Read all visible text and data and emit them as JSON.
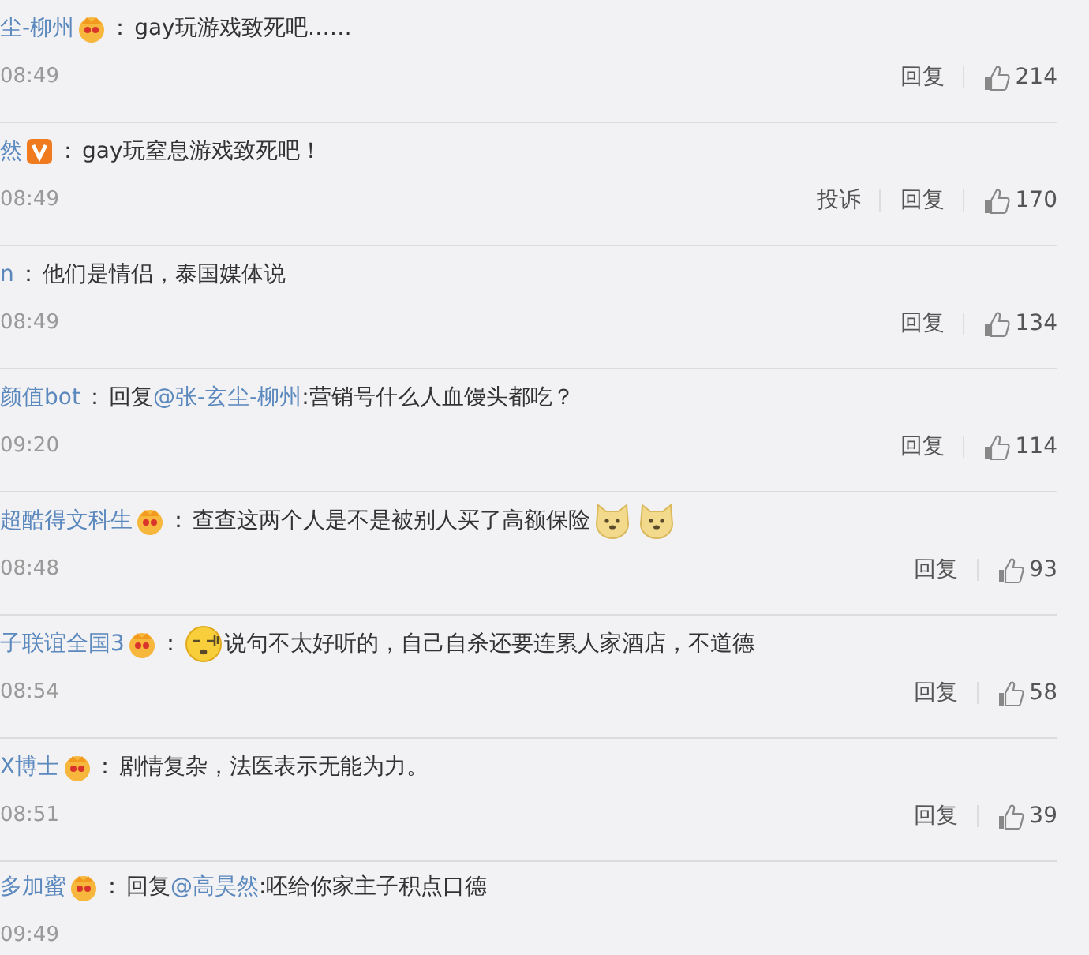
{
  "comments": [
    {
      "user": "尘-柳州",
      "badge": {
        "kind": "crown"
      },
      "colon": "：",
      "text": "gay玩游戏致死吧……",
      "time": "08:49",
      "actions": [
        "回复"
      ],
      "likes": "214"
    },
    {
      "user": "然",
      "badge": {
        "kind": "vip"
      },
      "colon": "：",
      "text": "gay玩窒息游戏致死吧！",
      "time": "08:49",
      "actions": [
        "投诉",
        "回复"
      ],
      "likes": "170"
    },
    {
      "user": "n",
      "colon": "：",
      "text": "他们是情侣，泰国媒体说",
      "time": "08:49",
      "actions": [
        "回复"
      ],
      "likes": "134"
    },
    {
      "user": "颜值bot",
      "colon": "：",
      "reply_prefix": "回复",
      "reply_to": "@张-玄尘-柳州",
      "text": ":营销号什么人血馒头都吃？",
      "time": "09:20",
      "actions": [
        "回复"
      ],
      "likes": "114"
    },
    {
      "user": "超酷得文科生",
      "badge": {
        "kind": "crown"
      },
      "colon": "：",
      "text": "查查这两个人是不是被别人买了高额保险",
      "emojis_after": [
        {
          "kind": "doge"
        },
        {
          "kind": "doge"
        }
      ],
      "time": "08:48",
      "actions": [
        "回复"
      ],
      "likes": "93"
    },
    {
      "user": "子联谊全国3",
      "badge": {
        "kind": "crown"
      },
      "colon": "：",
      "emojis_before": [
        {
          "kind": "sleepy"
        }
      ],
      "text": "说句不太好听的，自己自杀还要连累人家酒店，不道德",
      "time": "08:54",
      "actions": [
        "回复"
      ],
      "likes": "58"
    },
    {
      "user": "X博士",
      "badge": {
        "kind": "crown"
      },
      "colon": "：",
      "text": "剧情复杂，法医表示无能为力。",
      "time": "08:51",
      "actions": [
        "回复"
      ],
      "likes": "39"
    },
    {
      "user": "多加蜜",
      "badge": {
        "kind": "crown"
      },
      "colon": "：",
      "reply_prefix": "回复",
      "reply_to": "@高昊然",
      "text": ":呸给你家主子积点口德",
      "time": "09:49"
    }
  ]
}
